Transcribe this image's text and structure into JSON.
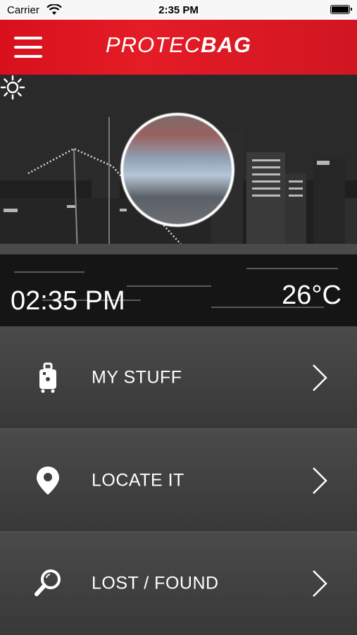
{
  "status_bar": {
    "carrier": "Carrier",
    "time": "2:35 PM"
  },
  "header": {
    "logo_part1": "PROTEC",
    "logo_part2": "BAG",
    "menu_icon": "hamburger-menu-icon"
  },
  "hero": {
    "clock": "02:35 PM",
    "temperature": "26°C",
    "weather_icon": "sun-icon"
  },
  "menu": {
    "items": [
      {
        "label": "MY STUFF",
        "icon": "luggage-icon"
      },
      {
        "label": "LOCATE IT",
        "icon": "location-pin-icon"
      },
      {
        "label": "LOST / FOUND",
        "icon": "magnifier-icon"
      }
    ]
  },
  "colors": {
    "brand_red": "#e41c26",
    "menu_bg": "#3f3f3f"
  }
}
